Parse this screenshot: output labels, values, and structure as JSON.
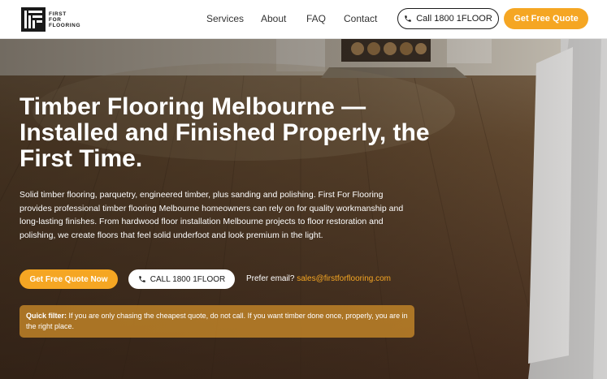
{
  "brand": {
    "logo_text_line1": "FIRST",
    "logo_text_line2": "FOR",
    "logo_text_line3": "FLOORING"
  },
  "nav": {
    "items": [
      "Services",
      "About",
      "FAQ",
      "Contact"
    ]
  },
  "header": {
    "call_label": "Call 1800 1FLOOR",
    "quote_label": "Get Free Quote"
  },
  "hero": {
    "title": "Timber Flooring Melbourne — Installed and Finished Properly, the First Time.",
    "body": "Solid timber flooring, parquetry, engineered timber, plus sanding and polishing. First For Flooring provides professional timber flooring Melbourne homeowners can rely on for quality workmanship and long-lasting finishes. From hardwood floor installation Melbourne projects to floor restoration and polishing, we create floors that feel solid underfoot and look premium in the light.",
    "quote_button": "Get Free Quote Now",
    "call_button": "CALL 1800 1FLOOR",
    "email_prefix": "Prefer email?",
    "email": "sales@firstforflooring.com",
    "filter_label": "Quick filter:",
    "filter_text": "If you are only chasing the cheapest quote, do not call. If you want timber done once, properly, you are in the right place."
  },
  "colors": {
    "accent": "#f5a623",
    "dark": "#1a1a1a"
  }
}
